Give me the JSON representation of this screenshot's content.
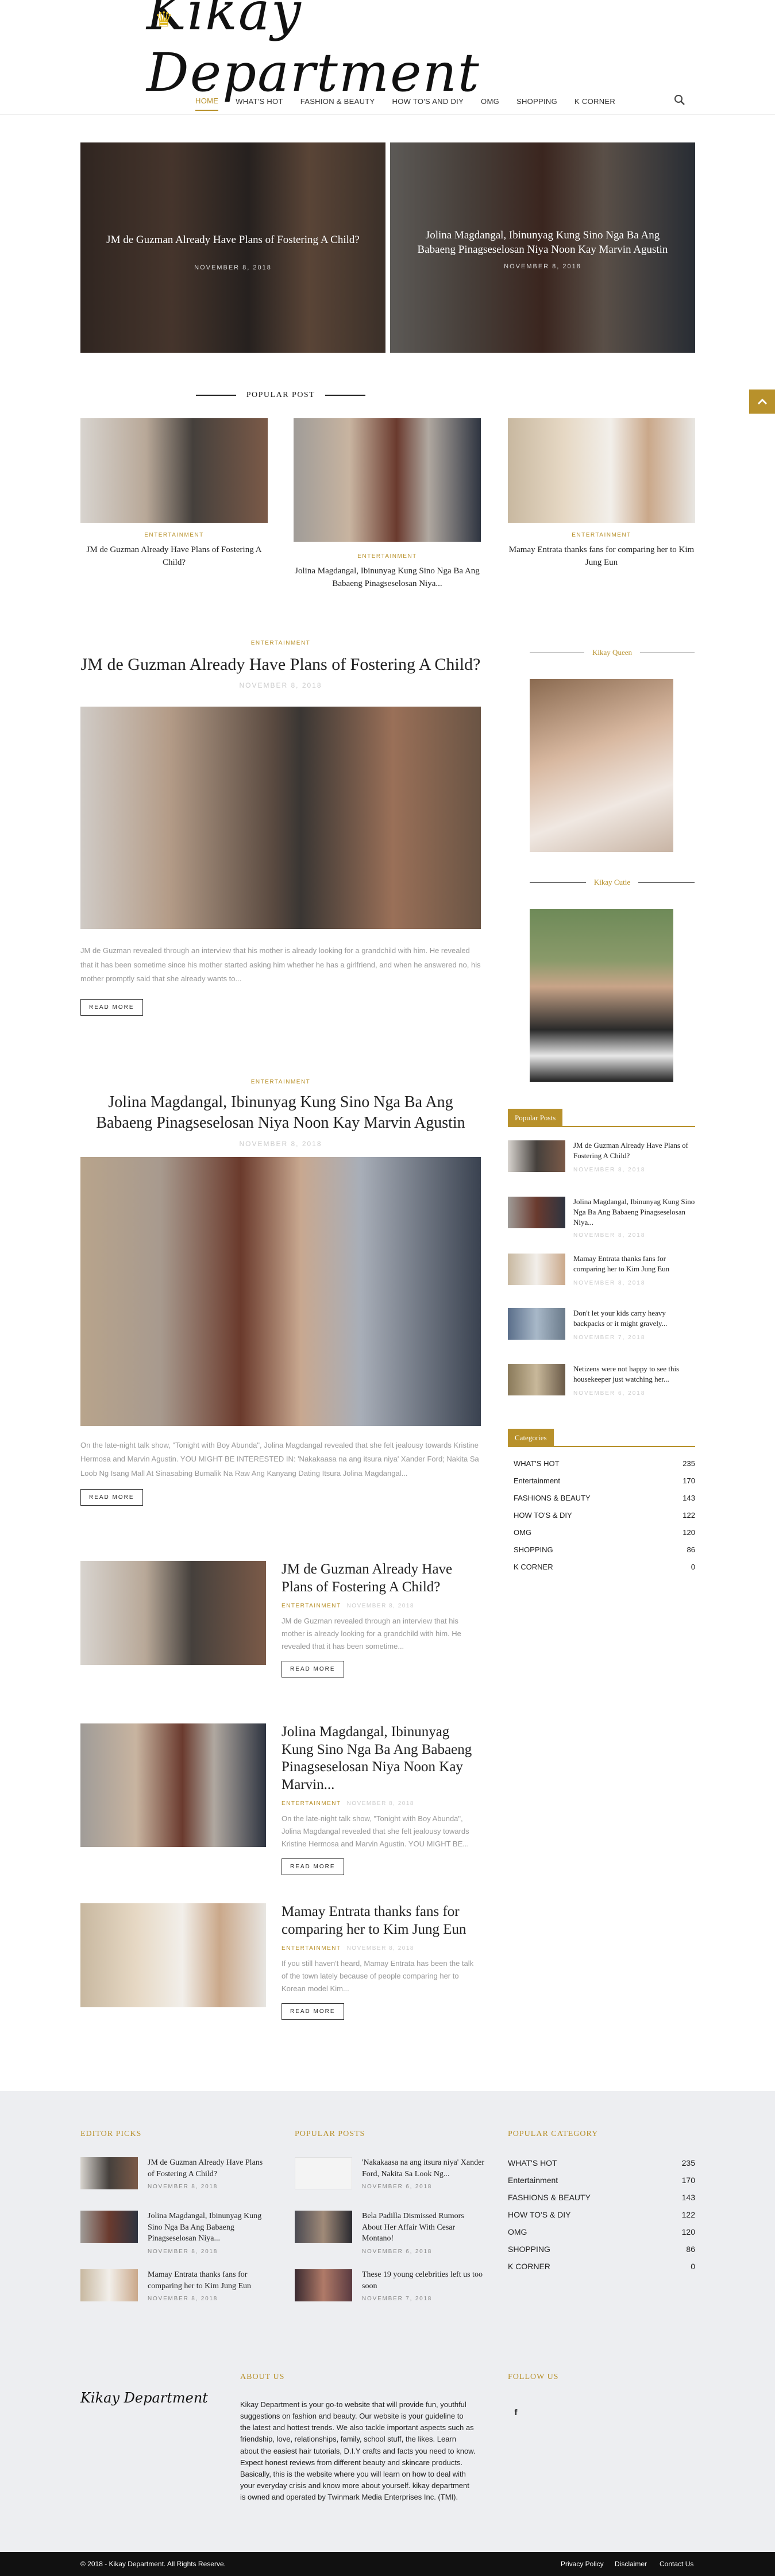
{
  "header": {
    "logo_text": "Kikay Department",
    "nav": [
      "HOME",
      "WHAT'S HOT",
      "FASHION & BEAUTY",
      "HOW TO'S AND DIY",
      "OMG",
      "SHOPPING",
      "K CORNER"
    ],
    "search_icon": "search-icon"
  },
  "featured": [
    {
      "title": "JM de Guzman Already Have Plans of Fostering A Child?",
      "date": "NOVEMBER 8, 2018"
    },
    {
      "title": "Jolina Magdangal, Ibinunyag Kung Sino Nga Ba Ang Babaeng Pinagseselosan Niya Noon Kay Marvin Agustin",
      "date": "NOVEMBER 8, 2018"
    }
  ],
  "popular_section_title": "POPULAR POST",
  "popular": [
    {
      "category": "ENTERTAINMENT",
      "title": "JM de Guzman Already Have Plans of Fostering A Child?"
    },
    {
      "category": "ENTERTAINMENT",
      "title": "Jolina Magdangal, Ibinunyag Kung Sino Nga Ba Ang Babaeng Pinagseselosan Niya..."
    },
    {
      "category": "ENTERTAINMENT",
      "title": "Mamay Entrata thanks fans for comparing her to Kim Jung Eun"
    }
  ],
  "posts": [
    {
      "category": "ENTERTAINMENT",
      "title": "JM de Guzman Already Have Plans of Fostering A Child?",
      "date": "NOVEMBER 8, 2018",
      "excerpt": "JM de Guzman revealed through an interview that his mother is already looking for a grandchild with him. He revealed that it has been sometime since his mother started asking him whether he has a girlfriend, and when he answered no, his mother promptly said that she already wants to...",
      "button": "READ MORE"
    },
    {
      "category": "ENTERTAINMENT",
      "title": "Jolina Magdangal, Ibinunyag Kung Sino Nga Ba Ang Babaeng Pinagseselosan Niya Noon Kay Marvin Agustin",
      "date": "NOVEMBER 8, 2018",
      "excerpt": "On the late-night talk show, \"Tonight with Boy Abunda\", Jolina Magdangal revealed that she felt jealousy towards Kristine Hermosa and Marvin Agustin. YOU MIGHT BE INTERESTED IN: 'Nakakaasa na ang itsura niya' Xander Ford; Nakita Sa Loob Ng Isang Mall At Sinasabing Bumalik Na Raw Ang Kanyang Dating Itsura Jolina Magdangal...",
      "button": "READ MORE"
    }
  ],
  "list_posts": [
    {
      "title": "JM de Guzman Already Have Plans of Fostering A Child?",
      "category": "ENTERTAINMENT",
      "date": "NOVEMBER 8, 2018",
      "excerpt": "JM de Guzman revealed through an interview that his mother is already looking for a grandchild with him. He revealed that it has been sometime...",
      "button": "READ MORE"
    },
    {
      "title": "Jolina Magdangal, Ibinunyag Kung Sino Nga Ba Ang Babaeng Pinagseselosan Niya Noon Kay Marvin...",
      "category": "ENTERTAINMENT",
      "date": "NOVEMBER 8, 2018",
      "excerpt": "On the late-night talk show, \"Tonight with Boy Abunda\", Jolina Magdangal revealed that she felt jealousy towards Kristine Hermosa and Marvin Agustin. YOU MIGHT BE...",
      "button": "READ MORE"
    },
    {
      "title": "Mamay Entrata thanks fans for comparing her to Kim Jung Eun",
      "category": "ENTERTAINMENT",
      "date": "NOVEMBER 8, 2018",
      "excerpt": "If you still haven't heard, Mamay Entrata has been the talk of the town lately because of people comparing her to Korean model Kim...",
      "button": "READ MORE"
    }
  ],
  "sidebar": {
    "queen_title": "Kikay Queen",
    "cutie_title": "Kikay Cutie",
    "popular_title": "Popular Posts",
    "popular": [
      {
        "title": "JM de Guzman Already Have Plans of Fostering A Child?",
        "date": "NOVEMBER 8, 2018"
      },
      {
        "title": "Jolina Magdangal, Ibinunyag Kung Sino Nga Ba Ang Babaeng Pinagseselosan Niya...",
        "date": "NOVEMBER 8, 2018"
      },
      {
        "title": "Mamay Entrata thanks fans for comparing her to Kim Jung Eun",
        "date": "NOVEMBER 8, 2018"
      },
      {
        "title": "Don't let your kids carry heavy backpacks or it might gravely...",
        "date": "NOVEMBER 7, 2018"
      },
      {
        "title": "Netizens were not happy to see this housekeeper just watching her...",
        "date": "NOVEMBER 6, 2018"
      }
    ],
    "categories_title": "Categories",
    "categories": [
      {
        "name": "WHAT'S HOT",
        "count": "235"
      },
      {
        "name": "Entertainment",
        "count": "170"
      },
      {
        "name": "FASHIONS & BEAUTY",
        "count": "143"
      },
      {
        "name": "HOW TO'S & DIY",
        "count": "122"
      },
      {
        "name": "OMG",
        "count": "120"
      },
      {
        "name": "SHOPPING",
        "count": "86"
      },
      {
        "name": "K CORNER",
        "count": "0"
      }
    ]
  },
  "footer": {
    "editor_title": "EDITOR PICKS",
    "editor": [
      {
        "title": "JM de Guzman Already Have Plans of Fostering A Child?",
        "date": "NOVEMBER 8, 2018"
      },
      {
        "title": "Jolina Magdangal, Ibinunyag Kung Sino Nga Ba Ang Babaeng Pinagseselosan Niya...",
        "date": "NOVEMBER 8, 2018"
      },
      {
        "title": "Mamay Entrata thanks fans for comparing her to Kim Jung Eun",
        "date": "NOVEMBER 8, 2018"
      }
    ],
    "popular_title": "POPULAR POSTS",
    "popular": [
      {
        "title": "'Nakakaasa na ang itsura niya' Xander Ford, Nakita Sa Look Ng...",
        "date": "NOVEMBER 6, 2018"
      },
      {
        "title": "Bela Padilla Dismissed Rumors About Her Affair With Cesar Montano!",
        "date": "NOVEMBER 6, 2018"
      },
      {
        "title": "These 19 young celebrities left us too soon",
        "date": "NOVEMBER 7, 2018"
      }
    ],
    "category_title": "POPULAR CATEGORY",
    "categories": [
      {
        "name": "WHAT'S HOT",
        "count": "235"
      },
      {
        "name": "Entertainment",
        "count": "170"
      },
      {
        "name": "FASHIONS & BEAUTY",
        "count": "143"
      },
      {
        "name": "HOW TO'S & DIY",
        "count": "122"
      },
      {
        "name": "OMG",
        "count": "120"
      },
      {
        "name": "SHOPPING",
        "count": "86"
      },
      {
        "name": "K CORNER",
        "count": "0"
      }
    ],
    "about_title": "ABOUT US",
    "about_logo": "Kikay Department",
    "about_text": "Kikay Department is your go-to website that will provide fun, youthful suggestions on fashion and beauty. Our website is your guideline to the latest and hottest trends. We also tackle important aspects such as friendship, love, relationships, family, school stuff, the likes. Learn about the easiest hair tutorials, D.I.Y crafts and facts you need to know. Expect honest reviews from different beauty and skincare products. Basically, this is the website where you will learn on how to deal with your everyday crisis and know more about yourself. kikay department is owned and operated by Twinmark Media Enterprises Inc. (TMI).",
    "follow_title": "FOLLOW US",
    "facebook_icon": "f"
  },
  "bottombar": {
    "copyright": "© 2018 - Kikay Department. All Rights Reserve.",
    "links": [
      "Privacy Policy",
      "Disclaimer",
      "Contact Us"
    ]
  },
  "colors": {
    "accent": "#b8912b",
    "footer_bg": "#edeef1",
    "bottom_bar": "#111111"
  }
}
